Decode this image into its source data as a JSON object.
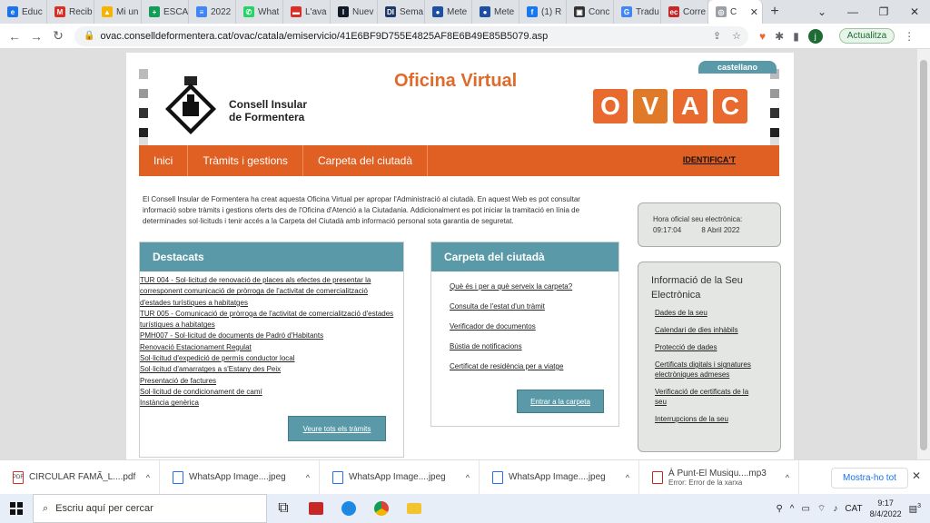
{
  "browser": {
    "tabs": [
      {
        "label": "Educ",
        "color": "#1a73e8",
        "glyph": "e"
      },
      {
        "label": "Recib",
        "color": "#d93025",
        "glyph": "M"
      },
      {
        "label": "Mi un",
        "color": "#f4b400",
        "glyph": "▲"
      },
      {
        "label": "ESCA",
        "color": "#0f9d58",
        "glyph": "+"
      },
      {
        "label": "2022",
        "color": "#4285f4",
        "glyph": "≡"
      },
      {
        "label": "What",
        "color": "#25d366",
        "glyph": "✆"
      },
      {
        "label": "L'ava",
        "color": "#d93025",
        "glyph": "▬"
      },
      {
        "label": "Nuev",
        "color": "#111827",
        "glyph": "I"
      },
      {
        "label": "Sema",
        "color": "#1f3a68",
        "glyph": "DI"
      },
      {
        "label": "Mete",
        "color": "#1e4fa0",
        "glyph": "●"
      },
      {
        "label": "Mete",
        "color": "#1e4fa0",
        "glyph": "●"
      },
      {
        "label": "(1) R",
        "color": "#1877f2",
        "glyph": "f"
      },
      {
        "label": "Conc",
        "color": "#333333",
        "glyph": "▣"
      },
      {
        "label": "Tradu",
        "color": "#4285f4",
        "glyph": "G"
      },
      {
        "label": "Corre",
        "color": "#c62828",
        "glyph": "ec"
      }
    ],
    "active_tab": {
      "label": "C",
      "close": "✕"
    },
    "new_tab": "+",
    "url": "ovac.conselldeformentera.cat/ovac/catala/emiservicio/41E6BF9D755E4825AF8E6B49E85B5079.asp",
    "update_label": "Actualitza",
    "avatar_letter": "j"
  },
  "site": {
    "brand_line1": "Consell Insular",
    "brand_line2": "de Formentera",
    "title": "Oficina Virtual",
    "ovac_letters": [
      "O",
      "V",
      "A",
      "C"
    ],
    "language_link": "castellano",
    "nav": [
      "Inici",
      "Tràmits i gestions",
      "Carpeta del ciutadà"
    ],
    "identifica": "IDENTIFICA'T",
    "intro": "El Consell Insular de Formentera ha creat aquesta Oficina Virtual per apropar l'Administració al ciutadà. En aquest Web es pot consultar informació sobre tràmits i gestions oferts des de l'Oficina d'Atenció a la Ciutadania. Addicionalment es pot iniciar la tramitació en línia de determinades sol·licituds i tenir accés a la Carpeta del Ciutadà amb informació personal sota garantia de seguretat.",
    "destacats": {
      "heading": "Destacats",
      "items": [
        "TUR 004 - Sol·licitud de renovació de places als efectes de presentar la",
        "corresponent comunicació de pròrroga de l'activitat de comercialització",
        "d'estades turístiques a habitatges",
        "TUR 005 - Comunicació de pròrroga de l'activitat de comercialització d'estades",
        "turístiques a habitatges",
        "PMH007 - Sol·licitud de documents de Padró d'Habitants",
        "Renovació Estacionament Regulat",
        "Sol·licitud d'expedició de permís conductor local",
        "Sol·licitud d'amarratges a s'Estany des Peix",
        "Presentació de factures",
        "Sol·licitud de condicionament de camí",
        "Instància genèrica"
      ],
      "button": "Veure tots els tràmits"
    },
    "carpeta": {
      "heading": "Carpeta del ciutadà",
      "items": [
        "Què és i per a què serveix la carpeta?",
        "Consulta de l'estat d'un tràmit",
        "Verificador de documentos",
        "Bústia de notificacions",
        "Certificat de residència per a viatge"
      ],
      "button": "Entrar a la carpeta"
    },
    "hora": {
      "label": "Hora oficial seu electrònica:",
      "time": "09:17:04",
      "date": "8 Abril 2022"
    },
    "info": {
      "heading": "Informació de la Seu Electrònica",
      "items": [
        "Dades de la seu",
        "Calendari de dies inhàbils",
        "Protecció de dades",
        "Certificats digitals i signatures electròniques admeses",
        "Verificació de certificats de la seu",
        "Interrupcions de la seu"
      ]
    }
  },
  "downloads": {
    "items": [
      {
        "name": "CIRCULAR FAMÃ_L....pdf",
        "type": "PDF",
        "sub": ""
      },
      {
        "name": "WhatsApp Image....jpeg",
        "type": "img",
        "sub": ""
      },
      {
        "name": "WhatsApp Image....jpeg",
        "type": "img",
        "sub": ""
      },
      {
        "name": "WhatsApp Image....jpeg",
        "type": "img",
        "sub": ""
      },
      {
        "name": "À Punt-El Musiqu....mp3",
        "type": "mp3",
        "sub": "Error: Error de la xarxa"
      }
    ],
    "show_all": "Mostra-ho tot"
  },
  "taskbar": {
    "search_placeholder": "Escriu aquí per cercar",
    "language": "CAT",
    "time": "9:17",
    "date": "8/4/2022",
    "notification_count": "3"
  },
  "colors": {
    "orange": "#e05f23",
    "teal": "#5a9aa8"
  }
}
